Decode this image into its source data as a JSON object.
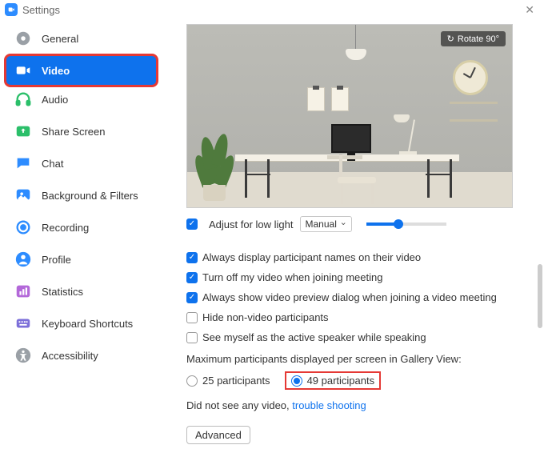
{
  "window": {
    "title": "Settings"
  },
  "sidebar": {
    "items": [
      {
        "id": "general",
        "label": "General"
      },
      {
        "id": "video",
        "label": "Video"
      },
      {
        "id": "audio",
        "label": "Audio"
      },
      {
        "id": "share-screen",
        "label": "Share Screen"
      },
      {
        "id": "chat",
        "label": "Chat"
      },
      {
        "id": "background-filters",
        "label": "Background & Filters"
      },
      {
        "id": "recording",
        "label": "Recording"
      },
      {
        "id": "profile",
        "label": "Profile"
      },
      {
        "id": "statistics",
        "label": "Statistics"
      },
      {
        "id": "keyboard-shortcuts",
        "label": "Keyboard Shortcuts"
      },
      {
        "id": "accessibility",
        "label": "Accessibility"
      }
    ],
    "active": "video"
  },
  "video": {
    "rotate_label": "Rotate 90°",
    "low_light": {
      "label": "Adjust for low light",
      "checked": true,
      "mode": "Manual",
      "slider": 40
    },
    "options": [
      {
        "id": "names",
        "label": "Always display participant names on their video",
        "checked": true
      },
      {
        "id": "turnoff",
        "label": "Turn off my video when joining meeting",
        "checked": true
      },
      {
        "id": "preview",
        "label": "Always show video preview dialog when joining a video meeting",
        "checked": true
      },
      {
        "id": "hide-nonvideo",
        "label": "Hide non-video participants",
        "checked": false
      },
      {
        "id": "see-self",
        "label": "See myself as the active speaker while speaking",
        "checked": false
      }
    ],
    "gallery": {
      "label": "Maximum participants displayed per screen in Gallery View:",
      "choices": [
        {
          "id": "25",
          "label": "25 participants",
          "checked": false
        },
        {
          "id": "49",
          "label": "49 participants",
          "checked": true
        }
      ]
    },
    "no_video": {
      "prefix": "Did not see any video, ",
      "link": "trouble shooting"
    },
    "advanced_label": "Advanced"
  }
}
